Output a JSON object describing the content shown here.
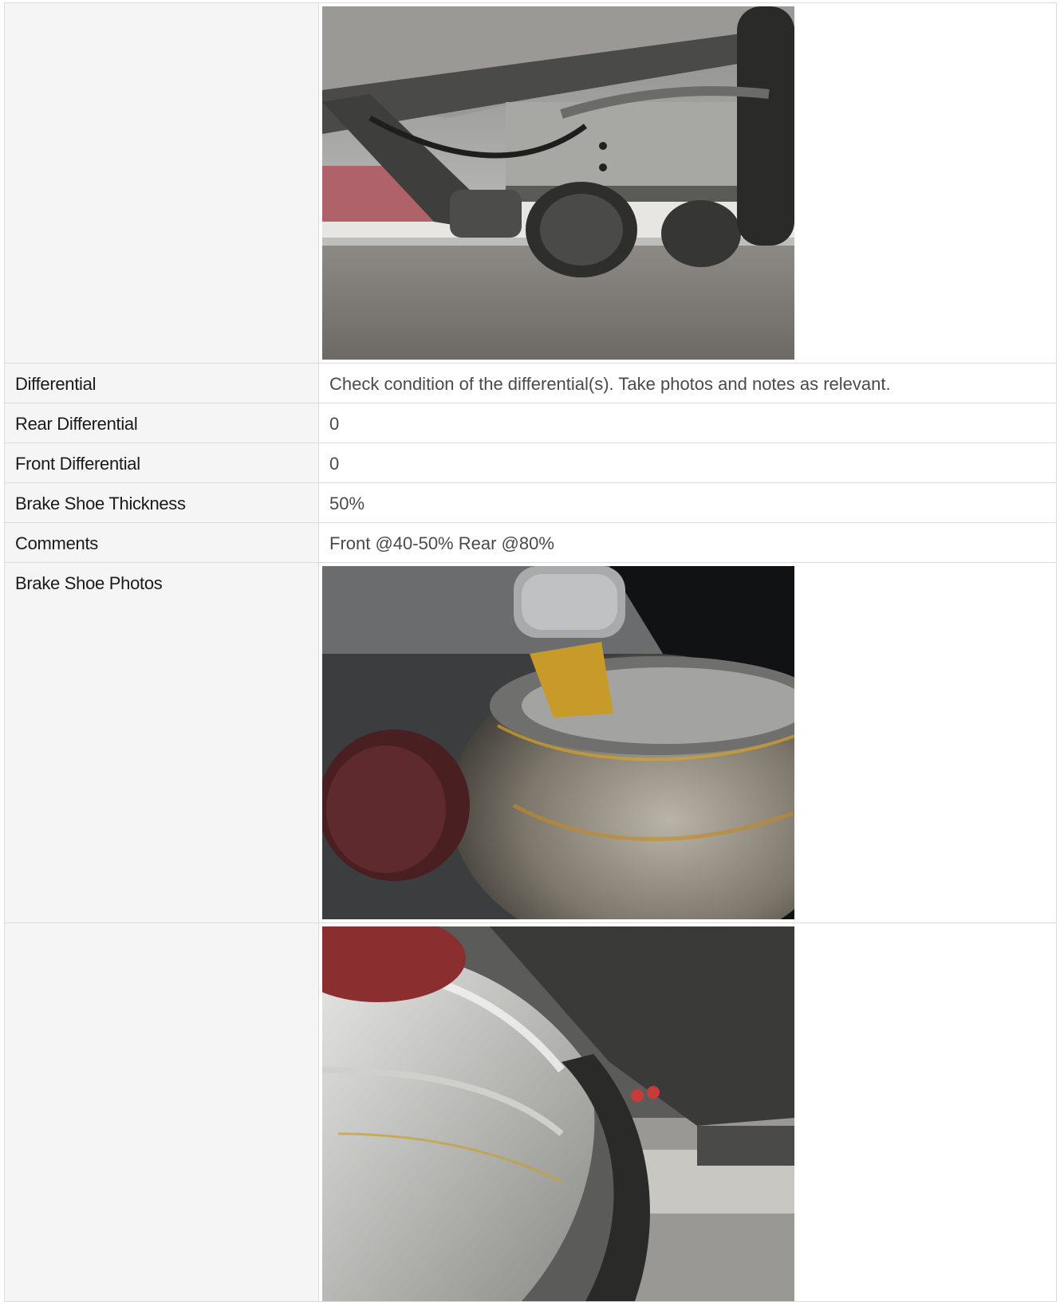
{
  "rows": {
    "differential": {
      "label": "Differential",
      "value": "Check condition of the differential(s). Take photos and notes as relevant."
    },
    "rear_differential": {
      "label": "Rear Differential",
      "value": "0"
    },
    "front_differential": {
      "label": "Front Differential",
      "value": "0"
    },
    "brake_shoe_thickness": {
      "label": "Brake Shoe Thickness",
      "value": "50%"
    },
    "comments": {
      "label": "Comments",
      "value": "Front @40-50% Rear @80%"
    },
    "brake_shoe_photos": {
      "label": "Brake Shoe Photos"
    }
  },
  "photos": [
    {
      "subject": "truck-undercarriage-axle-photo"
    },
    {
      "subject": "rusted-brake-drum-photo"
    },
    {
      "subject": "brake-shoe-closeup-photo"
    }
  ]
}
